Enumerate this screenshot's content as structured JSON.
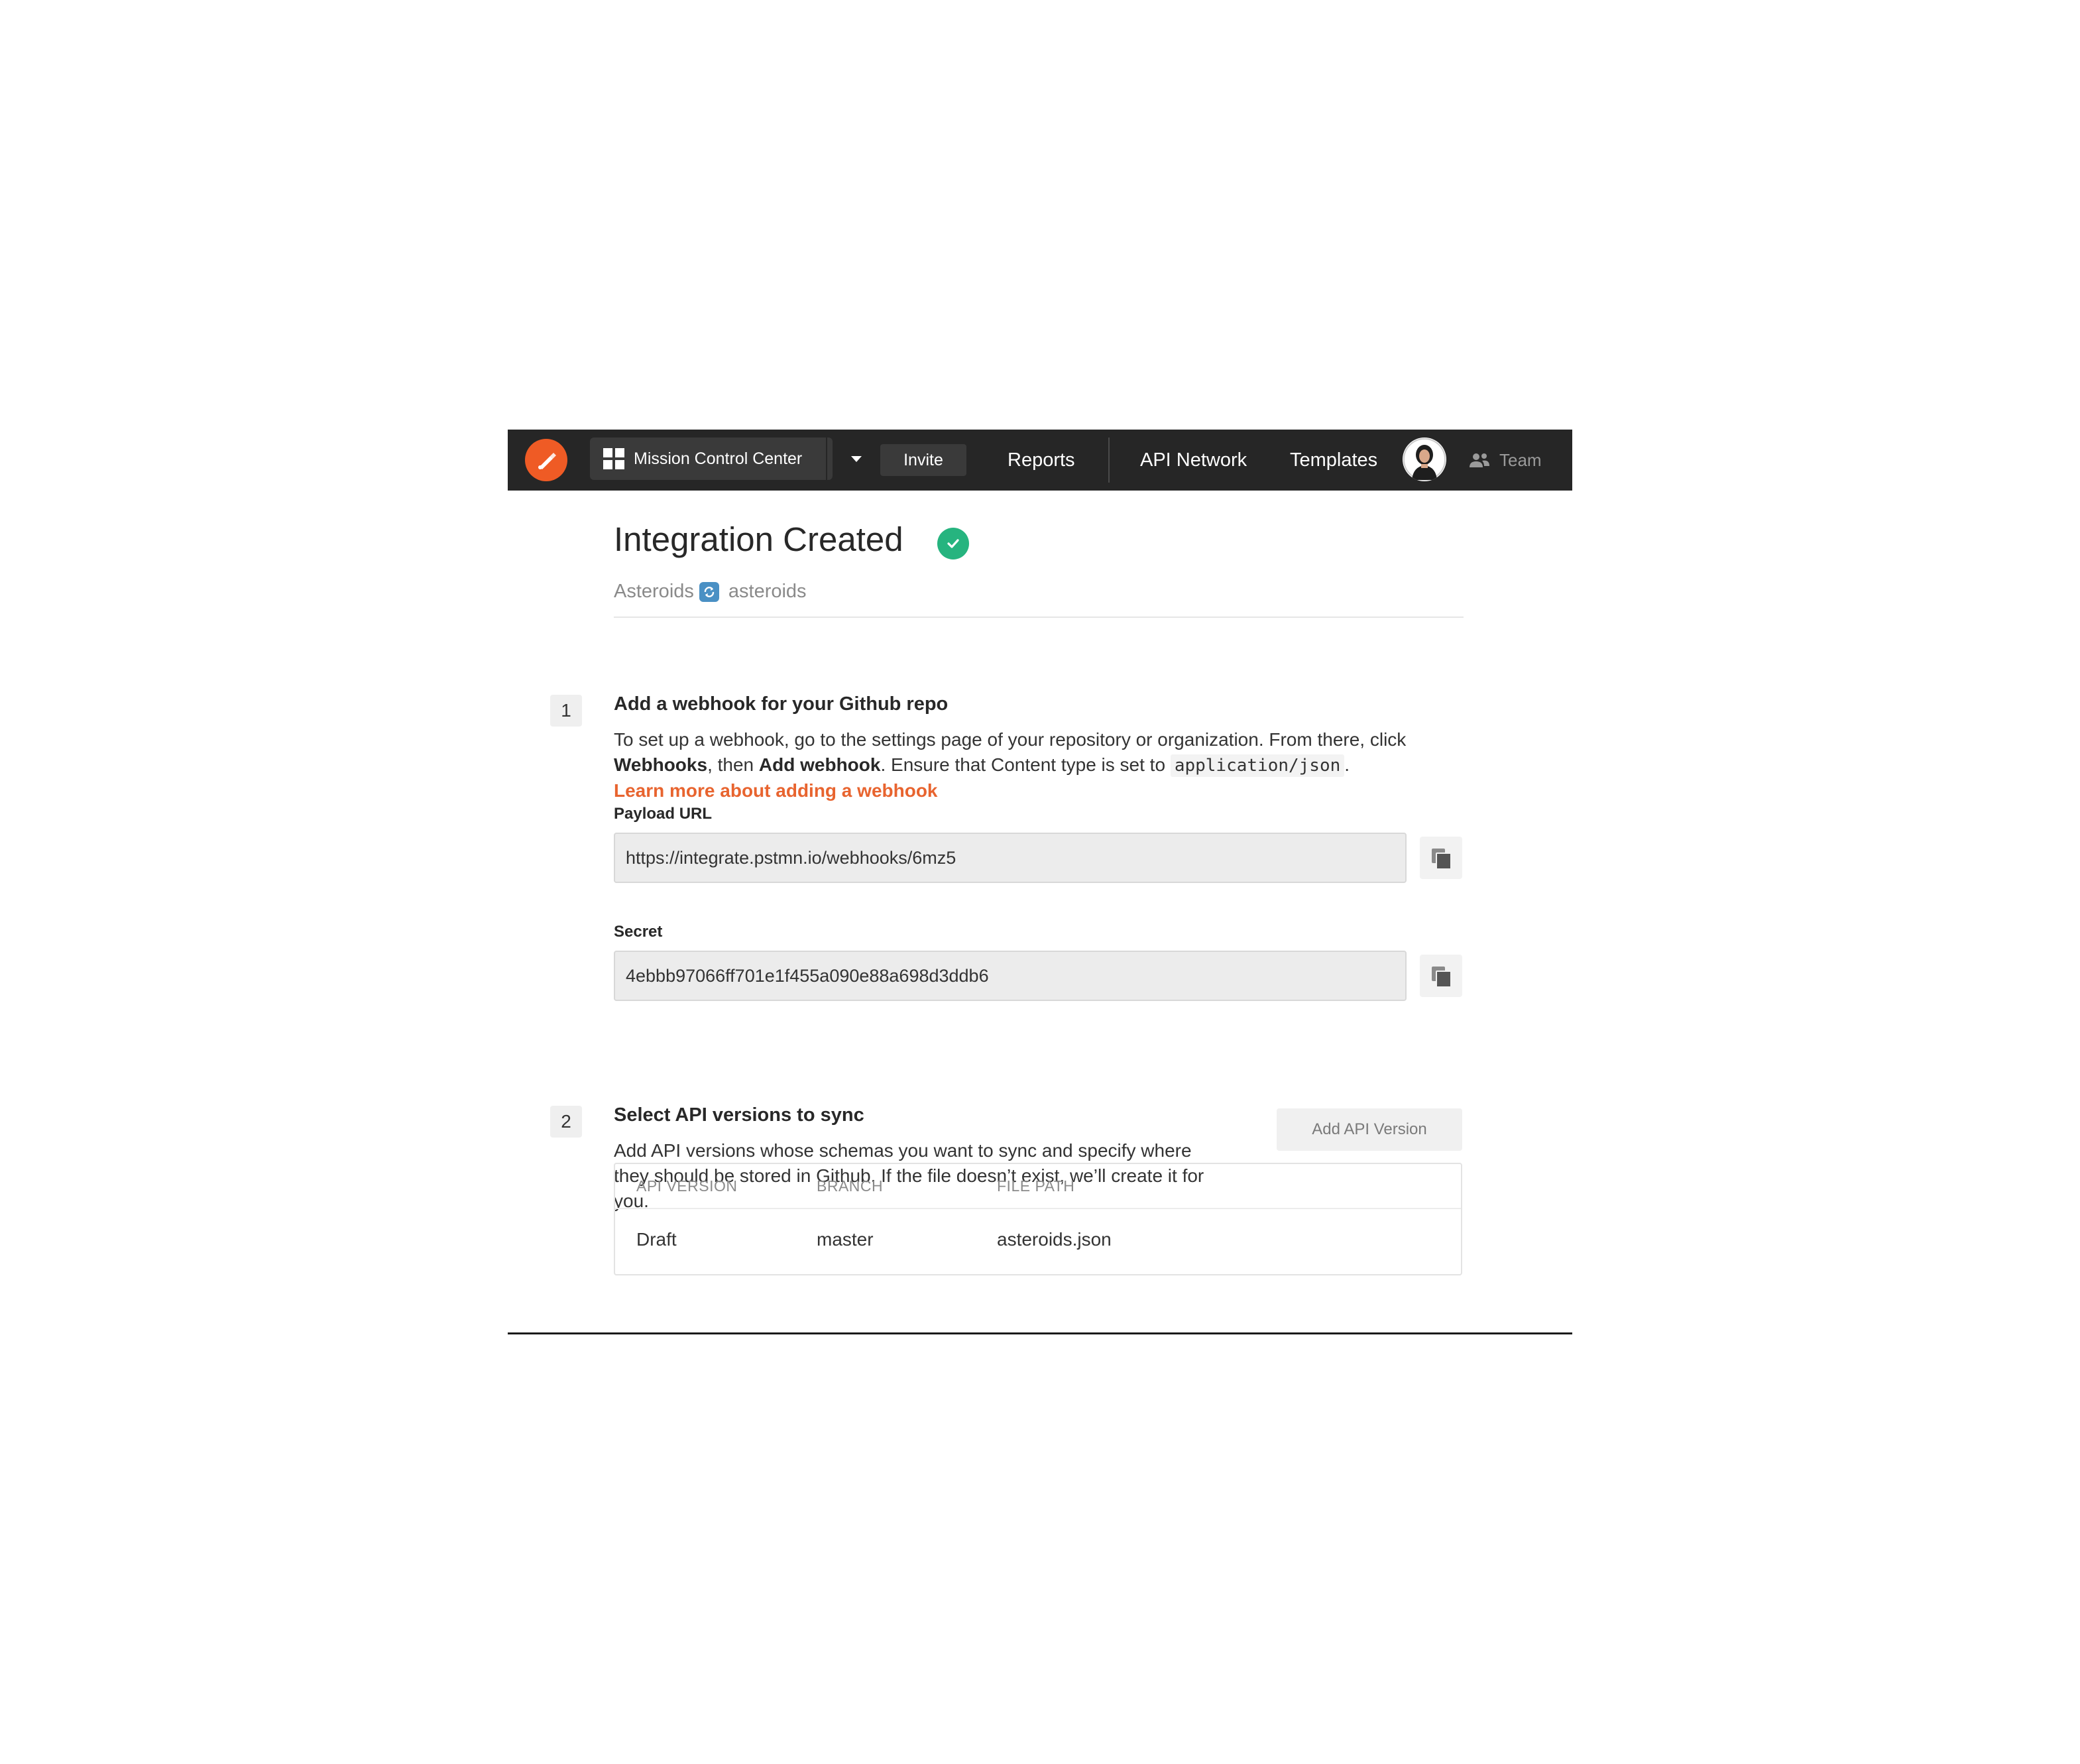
{
  "app": {
    "workspace_name": "Mission Control Center",
    "invite_label": "Invite",
    "nav": {
      "reports": "Reports",
      "api_network": "API Network",
      "templates": "Templates",
      "team": "Team"
    },
    "colors": {
      "topbar": "#262626",
      "brand": "#ef5b25",
      "success": "#26b47f",
      "link": "#e8642f"
    }
  },
  "page": {
    "title": "Integration Created",
    "breadcrumb": {
      "api": "Asteroids",
      "repo": "asteroids"
    }
  },
  "step1": {
    "number": "1",
    "title": "Add a webhook for your Github repo",
    "text_a": "To set up a webhook, go to the settings page of your repository or organization. From there, click ",
    "bold_webhooks": "Webhooks",
    "text_b": ", then ",
    "bold_add_webhook": "Add webhook",
    "text_c": ". Ensure that Content type is set to ",
    "content_type": "application/json",
    "text_d": ".",
    "learn_more": "Learn more about adding a webhook",
    "payload_label": "Payload URL",
    "payload_value": "https://integrate.pstmn.io/webhooks/6mz5",
    "secret_label": "Secret",
    "secret_value": "4ebbb97066ff701e1f455a090e88a698d3ddb6"
  },
  "step2": {
    "number": "2",
    "title": "Select API versions to sync",
    "description": "Add API versions whose schemas you want to sync and specify where they should be stored in Github.  If the file doesn’t exist, we’ll create it for you.",
    "add_button": "Add API Version",
    "table": {
      "headers": [
        "API VERSION",
        "BRANCH",
        "FILE PATH"
      ],
      "rows": [
        [
          "Draft",
          "master",
          "asteroids.json"
        ]
      ]
    }
  }
}
